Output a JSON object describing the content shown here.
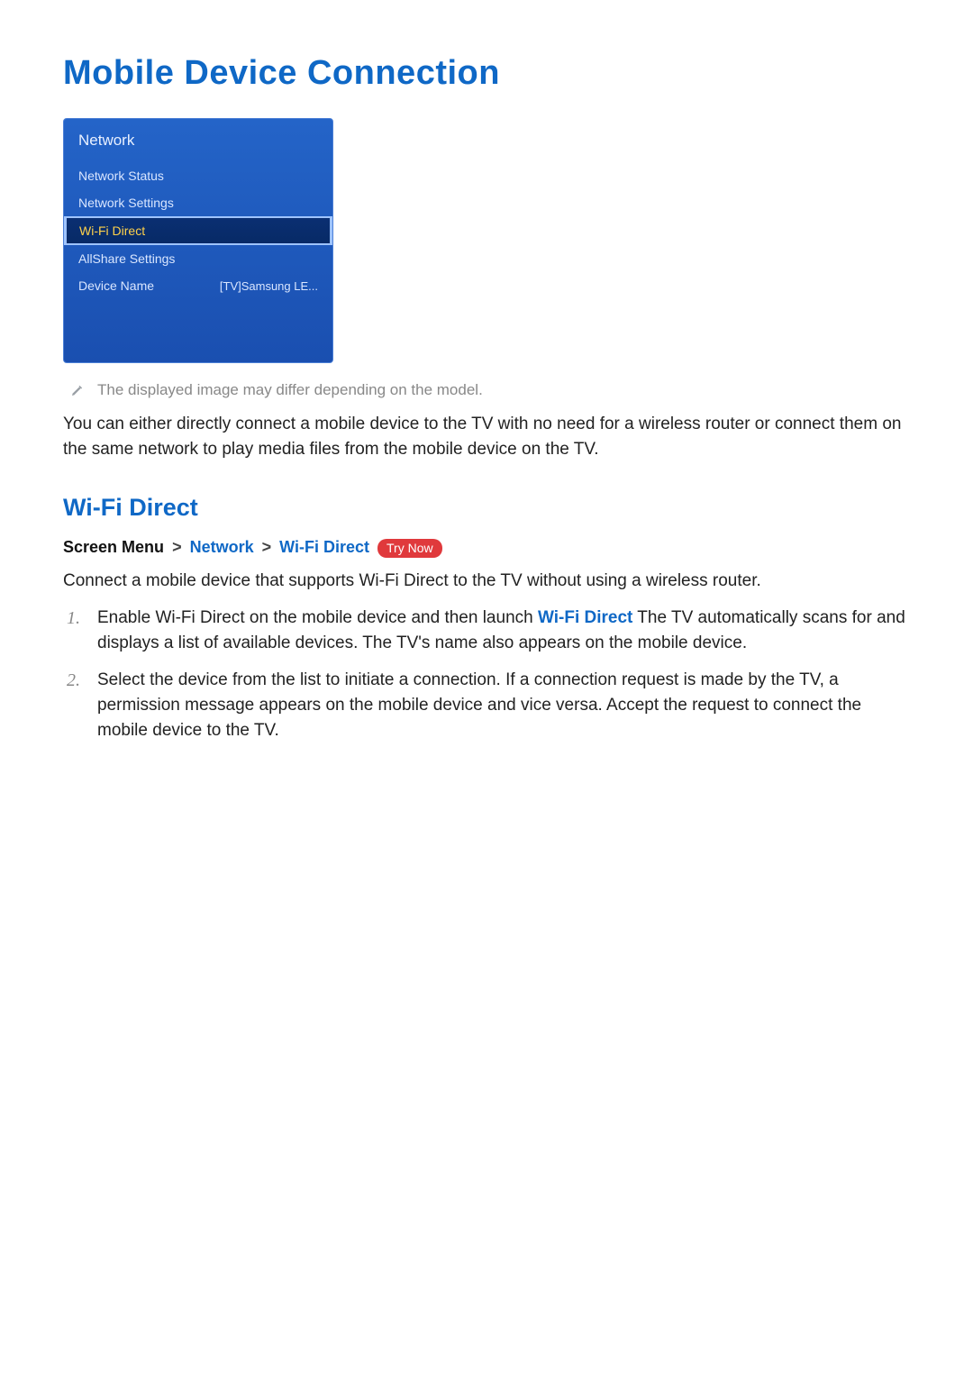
{
  "title": "Mobile Device Connection",
  "panel": {
    "header": "Network",
    "items": [
      {
        "label": "Network Status",
        "value": "",
        "selected": false
      },
      {
        "label": "Network Settings",
        "value": "",
        "selected": false
      },
      {
        "label": "Wi-Fi Direct",
        "value": "",
        "selected": true
      },
      {
        "label": "AllShare Settings",
        "value": "",
        "selected": false
      },
      {
        "label": "Device Name",
        "value": "[TV]Samsung LE...",
        "selected": false
      }
    ]
  },
  "note_icon": "pen-icon",
  "note_text": "The displayed image may differ depending on the model.",
  "intro": "You can either directly connect a mobile device to the TV with no need for a wireless router or connect them on the same network to play media files from the mobile device on the TV.",
  "section": {
    "heading": "Wi-Fi Direct",
    "breadcrumb": {
      "label": "Screen Menu",
      "sep": ">",
      "crumbs": [
        "Network",
        "Wi-Fi Direct"
      ],
      "badge": "Try Now"
    },
    "intro": "Connect a mobile device that supports Wi-Fi Direct to the TV without using a wireless router.",
    "steps": [
      {
        "pre": "Enable Wi-Fi Direct on the mobile device and then launch ",
        "hl": "Wi-Fi Direct",
        "post": " The TV automatically scans for and displays a list of available devices. The TV's name also appears on the mobile device."
      },
      {
        "pre": "Select the device from the list to initiate a connection. If a connection request is made by the TV, a permission message appears on the mobile device and vice versa. Accept the request to connect the mobile device to the TV.",
        "hl": "",
        "післ": ""
      }
    ]
  }
}
